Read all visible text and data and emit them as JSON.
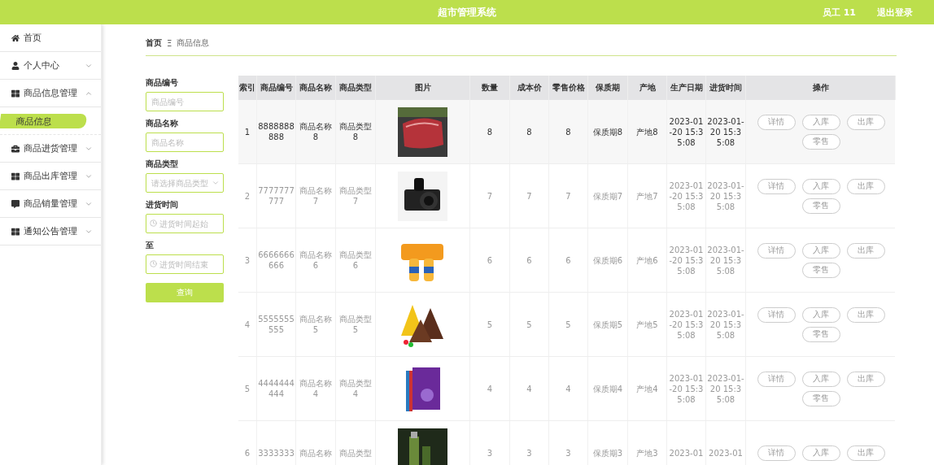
{
  "header": {
    "title": "超市管理系统",
    "user": "员工 11",
    "logout": "退出登录"
  },
  "sidebar": {
    "items": [
      {
        "label": "首页",
        "kind": "link"
      },
      {
        "label": "个人中心",
        "kind": "group",
        "expanded": false
      },
      {
        "label": "商品信息管理",
        "kind": "group",
        "expanded": true,
        "children": [
          {
            "label": "商品信息",
            "selected": true
          }
        ]
      },
      {
        "label": "商品进货管理",
        "kind": "group",
        "expanded": false
      },
      {
        "label": "商品出库管理",
        "kind": "group",
        "expanded": false
      },
      {
        "label": "商品销量管理",
        "kind": "group",
        "expanded": false
      },
      {
        "label": "通知公告管理",
        "kind": "group",
        "expanded": false
      }
    ]
  },
  "breadcrumb": {
    "home": "首页",
    "separator": "Ξ",
    "current": "商品信息"
  },
  "search": {
    "fields": [
      {
        "label": "商品编号",
        "kind": "text",
        "placeholder": "商品编号"
      },
      {
        "label": "商品名称",
        "kind": "text",
        "placeholder": "商品名称"
      },
      {
        "label": "商品类型",
        "kind": "select",
        "placeholder": "请选择商品类型"
      },
      {
        "label": "进货时间",
        "kind": "date",
        "placeholder": "进货时间起始"
      },
      {
        "label": "至",
        "kind": "date",
        "placeholder": "进货时间结束"
      }
    ],
    "button": "查询"
  },
  "table": {
    "columns": [
      "索引",
      "商品编号",
      "商品名称",
      "商品类型",
      "图片",
      "数量",
      "成本价",
      "零售价格",
      "保质期",
      "产地",
      "生产日期",
      "进货时间",
      "操作"
    ],
    "rows": [
      {
        "selected": true,
        "cells": [
          "1",
          "8888888888",
          "商品名称8",
          "商品类型8",
          "",
          "8",
          "8",
          "8",
          "保质期8",
          "产地8",
          "2023-01-20 15:35:08",
          "2023-01-20 15:35:08"
        ],
        "actions": [
          "详情",
          "入库",
          "出库",
          "零售"
        ]
      },
      {
        "selected": false,
        "cells": [
          "2",
          "7777777777",
          "商品名称7",
          "商品类型7",
          "",
          "7",
          "7",
          "7",
          "保质期7",
          "产地7",
          "2023-01-20 15:35:08",
          "2023-01-20 15:35:08"
        ],
        "actions": [
          "详情",
          "入库",
          "出库",
          "零售"
        ]
      },
      {
        "selected": false,
        "cells": [
          "3",
          "6666666666",
          "商品名称6",
          "商品类型6",
          "",
          "6",
          "6",
          "6",
          "保质期6",
          "产地6",
          "2023-01-20 15:35:08",
          "2023-01-20 15:35:08"
        ],
        "actions": [
          "详情",
          "入库",
          "出库",
          "零售"
        ]
      },
      {
        "selected": false,
        "cells": [
          "4",
          "5555555555",
          "商品名称5",
          "商品类型5",
          "",
          "5",
          "5",
          "5",
          "保质期5",
          "产地5",
          "2023-01-20 15:35:08",
          "2023-01-20 15:35:08"
        ],
        "actions": [
          "详情",
          "入库",
          "出库",
          "零售"
        ]
      },
      {
        "selected": false,
        "cells": [
          "5",
          "4444444444",
          "商品名称4",
          "商品类型4",
          "",
          "4",
          "4",
          "4",
          "保质期4",
          "产地4",
          "2023-01-20 15:35:08",
          "2023-01-20 15:35:08"
        ],
        "actions": [
          "详情",
          "入库",
          "出库",
          "零售"
        ]
      },
      {
        "selected": false,
        "cells": [
          "6",
          "3333333",
          "商品名称",
          "商品类型",
          "",
          "3",
          "3",
          "3",
          "保质期3",
          "产地3",
          "2023-01",
          "2023-01"
        ],
        "actions": [
          "详情",
          "入库",
          "出库"
        ]
      }
    ]
  }
}
